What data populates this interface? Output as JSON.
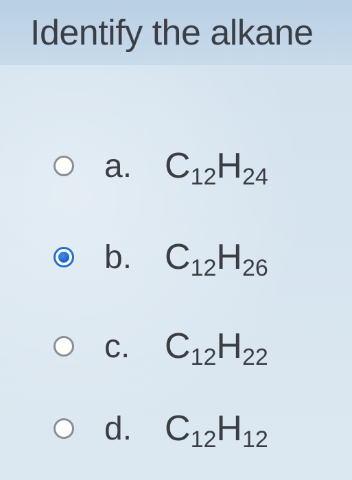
{
  "question": {
    "text": "Identify the alkane"
  },
  "options": [
    {
      "letter": "a.",
      "element1": "C",
      "count1": "12",
      "element2": "H",
      "count2": "24",
      "selected": false
    },
    {
      "letter": "b.",
      "element1": "C",
      "count1": "12",
      "element2": "H",
      "count2": "26",
      "selected": true
    },
    {
      "letter": "c.",
      "element1": "C",
      "count1": "12",
      "element2": "H",
      "count2": "22",
      "selected": false
    },
    {
      "letter": "d.",
      "element1": "C",
      "count1": "12",
      "element2": "H",
      "count2": "12",
      "selected": false
    }
  ],
  "colors": {
    "selected_radio": "#1f6fd1",
    "text": "#3a3d44",
    "background": "#d6e4ef"
  }
}
